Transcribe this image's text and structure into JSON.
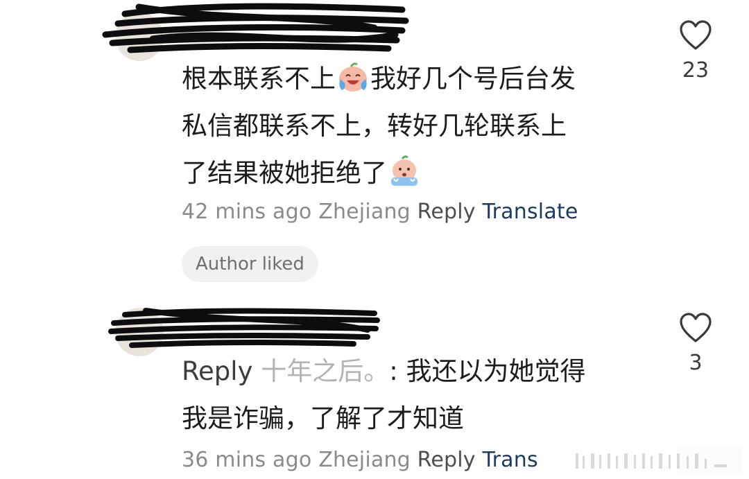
{
  "comments": [
    {
      "text_lines": [
        {
          "before": "根本联系不上",
          "emoji": "laughing-crying-emoji",
          "after": "我好几个号后台发"
        },
        {
          "before": "私信都联系不上，转好几轮联系上",
          "emoji": "",
          "after": ""
        },
        {
          "before": "了结果被她拒绝了",
          "emoji": "sobbing-emoji",
          "after": ""
        }
      ],
      "meta": {
        "time": "42 mins ago",
        "location": "Zhejiang",
        "reply": "Reply",
        "translate": "Translate"
      },
      "badge": "Author liked",
      "likes": "23"
    },
    {
      "reply_prefix": "Reply",
      "reply_to": "十年之后。",
      "text_lines": [
        ": 我还以为她觉得",
        "我是诈骗，了解了才知道"
      ],
      "meta": {
        "time": "36 mins ago",
        "location": "Zhejiang",
        "reply": "Reply",
        "translate": "Trans"
      },
      "likes": "3"
    }
  ],
  "icons": {
    "like": "heart-outline-icon"
  },
  "colors": {
    "translate_link": "#1e3a63",
    "meta_gray": "#8a8a8a",
    "badge_bg": "#f1f1f1"
  }
}
